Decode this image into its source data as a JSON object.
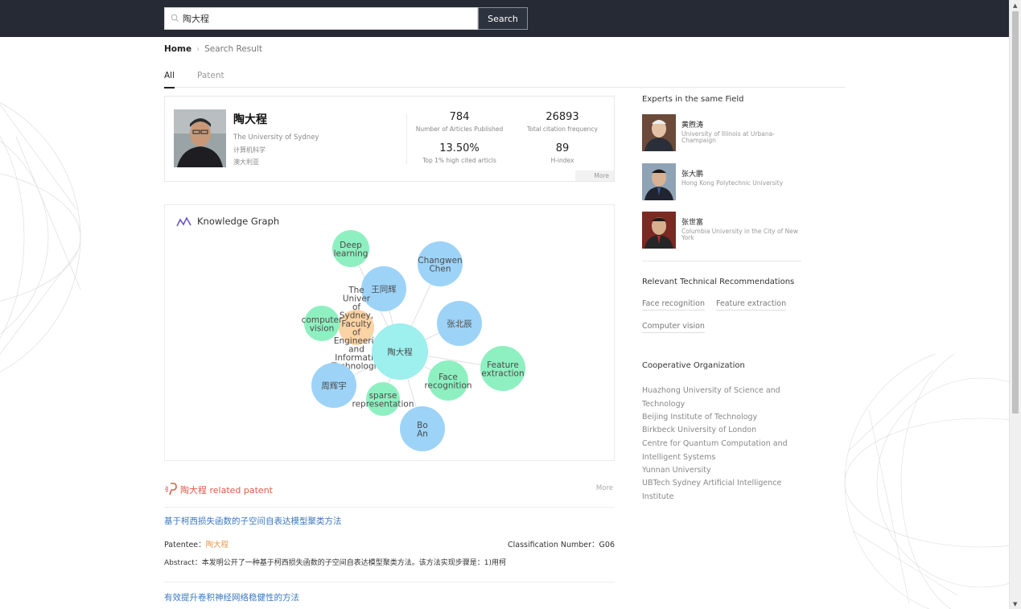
{
  "search": {
    "value": "陶大程",
    "button_label": "Search"
  },
  "breadcrumb": {
    "home": "Home",
    "current": "Search Result"
  },
  "tabs": [
    {
      "label": "All"
    },
    {
      "label": "Patent"
    }
  ],
  "profile": {
    "name": "陶大程",
    "university": "The University of Sydney",
    "field": "计算机科学",
    "country": "澳大利亚",
    "stats": [
      {
        "value": "784",
        "label": "Number of Articles Published"
      },
      {
        "value": "26893",
        "label": "Total citation frequency"
      },
      {
        "value": "13.50%",
        "label": "Top 1% high cited articls"
      },
      {
        "value": "89",
        "label": "H-index"
      }
    ],
    "more_label": "More"
  },
  "knowledge_graph": {
    "title": "Knowledge Graph",
    "nodes": [
      {
        "label": "Deep learning",
        "lines": [
          "Deep",
          "learning"
        ],
        "color": "#8ef0c0"
      },
      {
        "label": "Changwen Chen",
        "lines": [
          "Changwen",
          "Chen"
        ],
        "color": "#9dd3f7"
      },
      {
        "label": "王同辉",
        "lines": [
          "王同辉"
        ],
        "color": "#9dd3f7"
      },
      {
        "label": "The University of Sydney, Faculty of Engineering and Information Technologies",
        "lines": [
          "The",
          "Univer",
          "of",
          "Sydney,",
          "Faculty",
          "of",
          "Engineerin",
          "and",
          "Informatic",
          "Technologie"
        ],
        "color": "#fcd3a4"
      },
      {
        "label": "computer vision",
        "lines": [
          "computer",
          "vision"
        ],
        "color": "#8ef0c0"
      },
      {
        "label": "张北辰",
        "lines": [
          "张北辰"
        ],
        "color": "#9dd3f7"
      },
      {
        "label": "陶大程",
        "lines": [
          "陶大程"
        ],
        "color": "#9df0ee"
      },
      {
        "label": "Feature extraction",
        "lines": [
          "Feature",
          "extraction"
        ],
        "color": "#8ef0c0"
      },
      {
        "label": "Face recognition",
        "lines": [
          "Face",
          "recognition"
        ],
        "color": "#8ef0c0"
      },
      {
        "label": "周辉宇",
        "lines": [
          "周辉宇"
        ],
        "color": "#9dd3f7"
      },
      {
        "label": "sparse representation",
        "lines": [
          "sparse",
          "representation"
        ],
        "color": "#8ef0c0"
      },
      {
        "label": "Bo An",
        "lines": [
          "Bo",
          "An"
        ],
        "color": "#9dd3f7"
      }
    ]
  },
  "patents": {
    "header": "陶大程 related patent",
    "more_label": "More",
    "items": [
      {
        "title": "基于柯西损失函数的子空间自表达模型聚类方法",
        "patentee_label": "Patentee：",
        "patentee": "陶大程",
        "classification": "Classification Number：G06",
        "abstract": "Abstract：本发明公开了一种基于柯西损失函数的子空间自表达模型聚类方法。该方法实现步骤是：1)用柯"
      },
      {
        "title": "有效提升卷积神经网络稳健性的方法"
      }
    ]
  },
  "sidebar": {
    "experts_title": "Experts in the same Field",
    "experts": [
      {
        "name": "黄煦涛",
        "org": "University of Illinois at Urbana-Champaign"
      },
      {
        "name": "张大鹏",
        "org": "Hong Kong Polytechnic University"
      },
      {
        "name": "张世富",
        "org": "Columbia University in the City of New York"
      }
    ],
    "recommend_title": "Relevant Technical Recommendations",
    "recommendations": [
      "Face recognition",
      "Feature extraction",
      "Computer vision"
    ],
    "coop_title": "Cooperative Organization",
    "organizations": [
      "Huazhong University of Science and Technology",
      "Beijing Institute of Technology",
      "Birkbeck University of London",
      "Centre for Quantum Computation and Intelligent Systems",
      "Yunnan University",
      "UBTech Sydney Artificial Intelligence Institute"
    ]
  }
}
